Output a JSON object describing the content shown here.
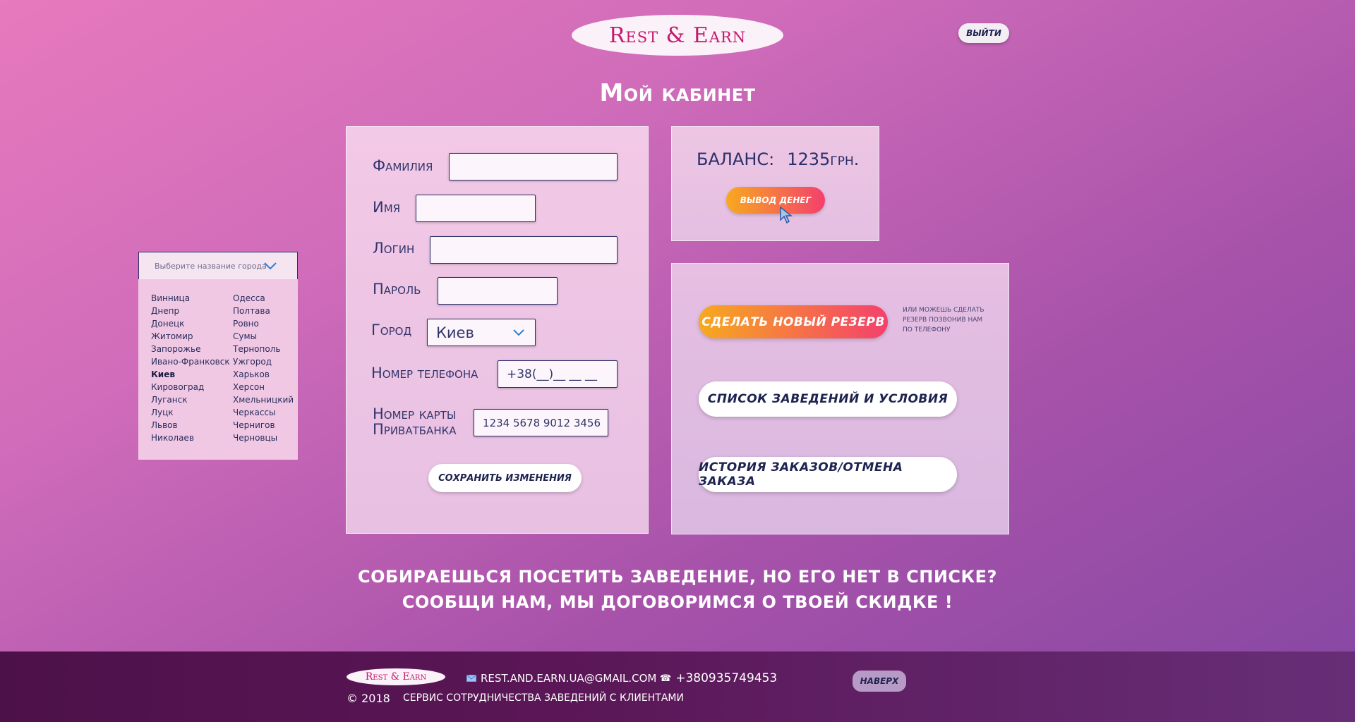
{
  "header": {
    "logo": "Rest & Earn",
    "exit_label": "ВЫЙТИ",
    "page_title": "Мой кабинет"
  },
  "city_picker": {
    "placeholder": "Выберите название города",
    "col1": [
      "Винница",
      "Днепр",
      "Донецк",
      "Житомир",
      "Запорожье",
      "Ивано-Франковск",
      "Киев",
      "Кировоград",
      "Луганск",
      "Луцк",
      "Львов",
      "Николаев"
    ],
    "col2": [
      "Одесса",
      "Полтава",
      "Ровно",
      "Сумы",
      "Тернополь",
      "Ужгород",
      "Харьков",
      "Херсон",
      "Хмельницкий",
      "Черкассы",
      "Чернигов",
      "Черновцы"
    ],
    "selected": "Киев"
  },
  "form": {
    "surname_label": "Фамилия",
    "surname_value": "",
    "name_label": "Имя",
    "name_value": "",
    "login_label": "Логин",
    "login_value": "",
    "password_label": "Пароль",
    "password_value": "",
    "city_label": "Город",
    "city_value": "Киев",
    "phone_label": "Номер телефона",
    "phone_value": "+38(__)__ __ __",
    "card_label_line1": "Номер карты",
    "card_label_line2": "Приватбанка",
    "card_value": "1234 5678 9012 3456",
    "save_label": "СОХРАНИТЬ ИЗМЕНЕНИЯ"
  },
  "balance": {
    "label": "БАЛАНС:",
    "amount": "1235грн.",
    "withdraw_label": "ВЫВОД ДЕНЕГ"
  },
  "actions": {
    "new_reserve_label": "СДЕЛАТЬ НОВЫЙ РЕЗЕРВ",
    "reserve_note": "ИЛИ МОЖЕШЬ СДЕЛАТЬ РЕЗЕРВ ПОЗВОНИВ НАМ ПО ТЕЛЕФОНУ",
    "venues_label": "СПИСОК ЗАВЕДЕНИЙ И УСЛОВИЯ",
    "history_label": "ИСТОРИЯ ЗАКАЗОВ/ОТМЕНА ЗАКАЗА"
  },
  "promo": {
    "line1": "СОБИРАЕШЬСЯ ПОСЕТИТЬ ЗАВЕДЕНИЕ, НО ЕГО НЕТ В СПИСКЕ?",
    "line2": "СООБЩИ НАМ, МЫ ДОГОВОРИМСЯ О ТВОЕЙ СКИДКЕ !"
  },
  "footer": {
    "logo": "Rest & Earn",
    "email": "REST.AND.EARN.UA@GMAIL.COM",
    "phone": "+380935749453",
    "copyright": "© 2018",
    "service": "СЕРВИС СОТРУДНИЧЕСТВА ЗАВЕДЕНИЙ С КЛИЕНТАМИ",
    "top_label": "НАВЕРХ"
  },
  "colors": {
    "accent_orange": "#f7a91e",
    "accent_pink": "#f4406d",
    "text_navy": "#1e2350",
    "logo_text": "#c21a6e"
  }
}
